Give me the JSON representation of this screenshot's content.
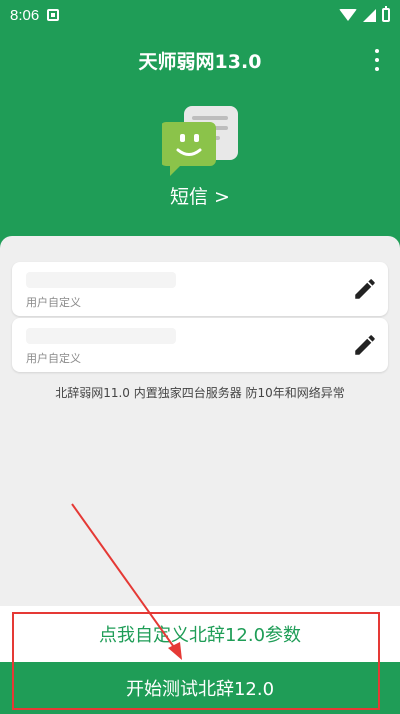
{
  "status_bar": {
    "time": "8:06",
    "icons": [
      "notification-icon",
      "wifi-icon",
      "signal-icon",
      "battery-icon"
    ]
  },
  "app_bar": {
    "title": "天师弱网13.0",
    "menu_icon": "more-vert-icon"
  },
  "header": {
    "icon": "sms-icon",
    "label": "短信 >"
  },
  "fields": [
    {
      "placeholder": "用户自定义",
      "icon": "edit-icon"
    },
    {
      "placeholder": "用户自定义",
      "icon": "edit-icon"
    }
  ],
  "info_text": "北辞弱网11.0 内置独家四台服务器 防10年和网络异常",
  "buttons": {
    "customize": "点我自定义北辞12.0参数",
    "start": "开始测试北辞12.0"
  },
  "colors": {
    "primary": "#1f9d57",
    "annotation": "#e53935",
    "background": "#efefef"
  }
}
